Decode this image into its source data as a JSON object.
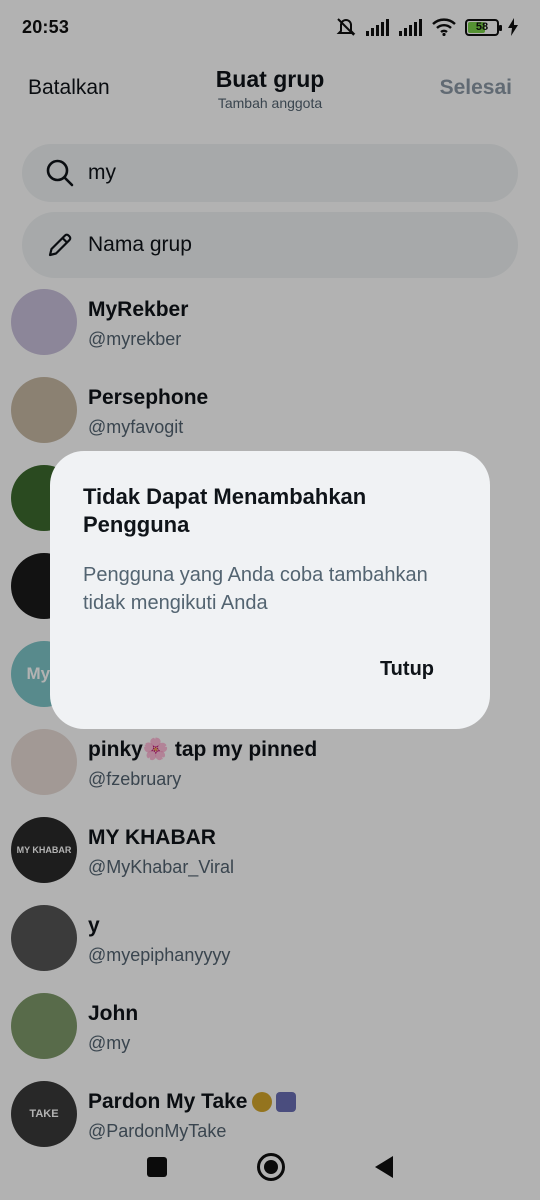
{
  "status_bar": {
    "time": "20:53",
    "battery": "58",
    "icons": [
      "mute-icon",
      "signal-icon",
      "signal-icon",
      "wifi-icon",
      "battery-icon",
      "charging-icon"
    ]
  },
  "header": {
    "cancel_label": "Batalkan",
    "title": "Buat grup",
    "subtitle": "Tambah anggota",
    "done_label": "Selesai"
  },
  "search": {
    "value": "my",
    "icon": "search-icon"
  },
  "group_name": {
    "placeholder": "Nama grup",
    "icon": "pencil-icon"
  },
  "users": [
    {
      "name": "MyRekber",
      "handle": "@myrekber",
      "avatar_color": "#c9c0dc",
      "avatar_text": ""
    },
    {
      "name": "Persephone",
      "handle": "@myfavogit",
      "avatar_color": "#c8b9a4",
      "avatar_text": ""
    },
    {
      "name": "",
      "handle": "",
      "avatar_color": "#3d6b2e",
      "avatar_text": ""
    },
    {
      "name": "",
      "handle": "",
      "avatar_color": "#1a1a1a",
      "avatar_text": ""
    },
    {
      "name": "",
      "handle": "",
      "avatar_color": "#7fc6c9",
      "avatar_text": "MyS"
    },
    {
      "name": "pinky🌸 tap my pinned",
      "handle": "@fzebruary",
      "avatar_color": "#e8dcd6",
      "avatar_text": ""
    },
    {
      "name": "MY KHABAR",
      "handle": "@MyKhabar_Viral",
      "avatar_color": "#2a2a2a",
      "avatar_text": "MY KHABAR"
    },
    {
      "name": "y",
      "handle": "@myepiphanyyyy",
      "avatar_color": "#555555",
      "avatar_text": ""
    },
    {
      "name": "John",
      "handle": "@my",
      "avatar_color": "#7f9a6a",
      "avatar_text": ""
    },
    {
      "name": "Pardon My Take",
      "handle": "@PardonMyTake",
      "avatar_color": "#3a3a3a",
      "avatar_text": "TAKE"
    }
  ],
  "dialog": {
    "title": "Tidak Dapat Menambahkan Pengguna",
    "message": "Pengguna yang Anda coba tambahkan tidak mengikuti Anda",
    "button": "Tutup"
  },
  "navigation": {
    "icons": [
      "recents-square-icon",
      "home-circle-icon",
      "back-triangle-icon"
    ]
  }
}
